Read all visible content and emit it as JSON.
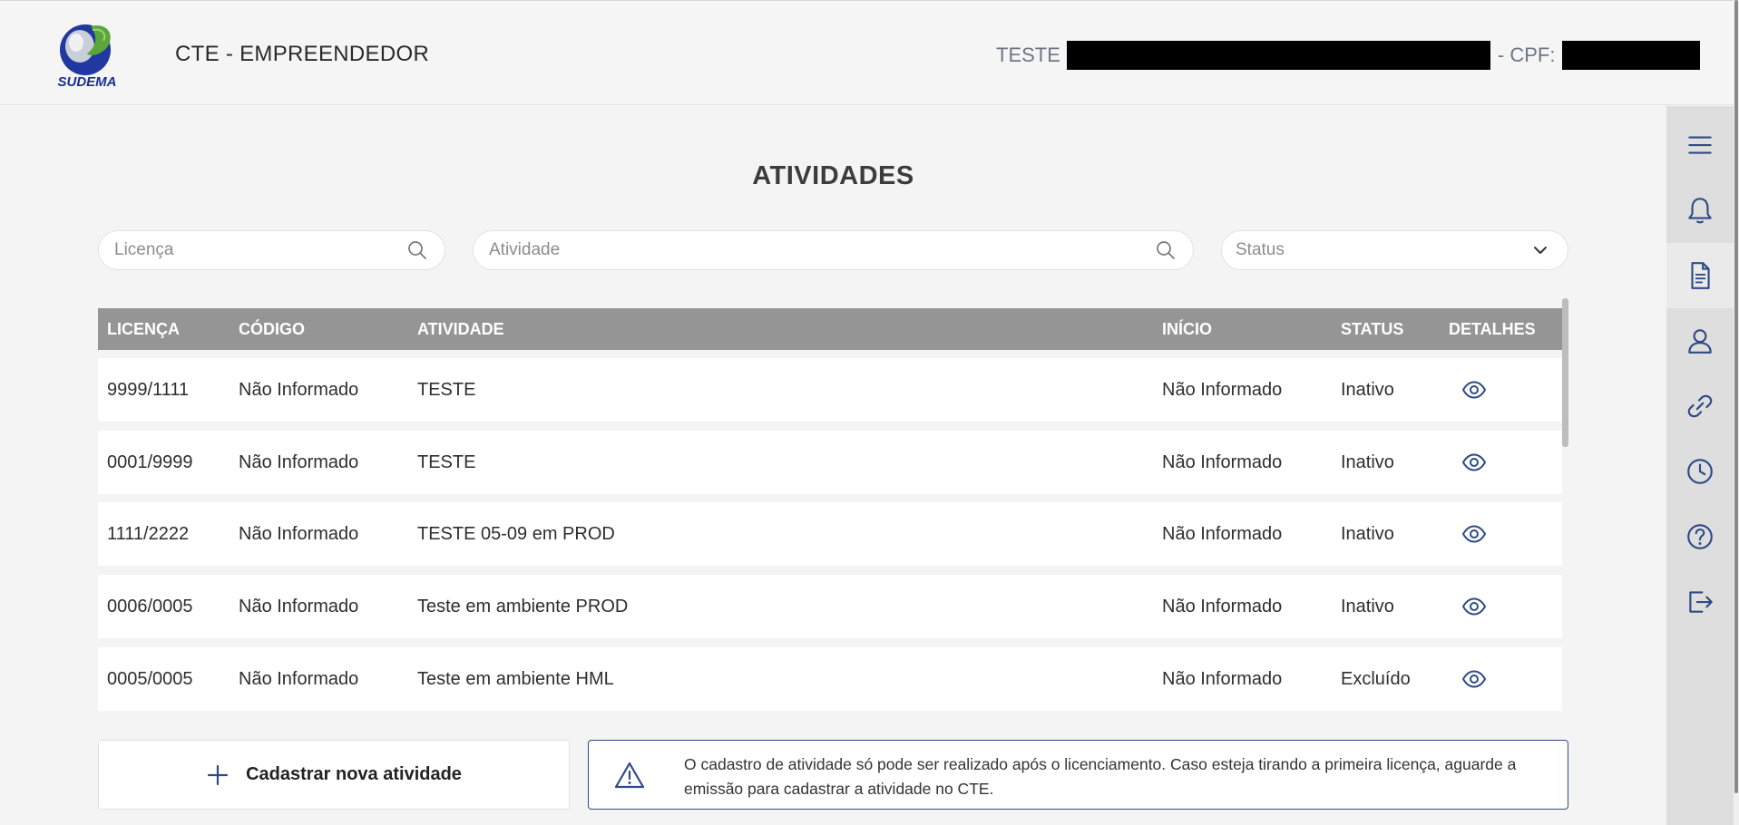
{
  "header": {
    "logo_text": "SUDEMA",
    "app_title": "CTE - EMPREENDEDOR",
    "user_label": "TESTE",
    "cpf_label": "- CPF:"
  },
  "page": {
    "title": "ATIVIDADES"
  },
  "filters": {
    "license_placeholder": "Licença",
    "activity_placeholder": "Atividade",
    "status_placeholder": "Status"
  },
  "table": {
    "columns": [
      "LICENÇA",
      "CÓDIGO",
      "ATIVIDADE",
      "INÍCIO",
      "STATUS",
      "DETALHES"
    ],
    "rows": [
      {
        "licenca": "9999/1111",
        "codigo": "Não Informado",
        "atividade": "TESTE",
        "inicio": "Não Informado",
        "status": "Inativo"
      },
      {
        "licenca": "0001/9999",
        "codigo": "Não Informado",
        "atividade": "TESTE",
        "inicio": "Não Informado",
        "status": "Inativo"
      },
      {
        "licenca": "1111/2222",
        "codigo": "Não Informado",
        "atividade": "TESTE 05-09 em PROD",
        "inicio": "Não Informado",
        "status": "Inativo"
      },
      {
        "licenca": "0006/0005",
        "codigo": "Não Informado",
        "atividade": "Teste em ambiente PROD",
        "inicio": "Não Informado",
        "status": "Inativo"
      },
      {
        "licenca": "0005/0005",
        "codigo": "Não Informado",
        "atividade": "Teste em ambiente HML",
        "inicio": "Não Informado",
        "status": "Excluído"
      }
    ]
  },
  "actions": {
    "add_label": "Cadastrar nova atividade"
  },
  "notice": {
    "text": "O cadastro de atividade só pode ser realizado após o licenciamento. Caso esteja tirando a primeira licença, aguarde a emissão para cadastrar a atividade no CTE."
  },
  "rail": {
    "icons": [
      "menu-icon",
      "bell-icon",
      "document-icon",
      "user-icon",
      "link-icon",
      "clock-icon",
      "help-icon",
      "logout-icon"
    ],
    "active": "document-icon"
  },
  "colors": {
    "header_bg": "#f5f5f5",
    "table_header": "#959595",
    "icon_blue": "#2e4a86",
    "rail_bg": "#dedede",
    "logo_blue": "#1b2f8f",
    "logo_green": "#5aa63a"
  }
}
